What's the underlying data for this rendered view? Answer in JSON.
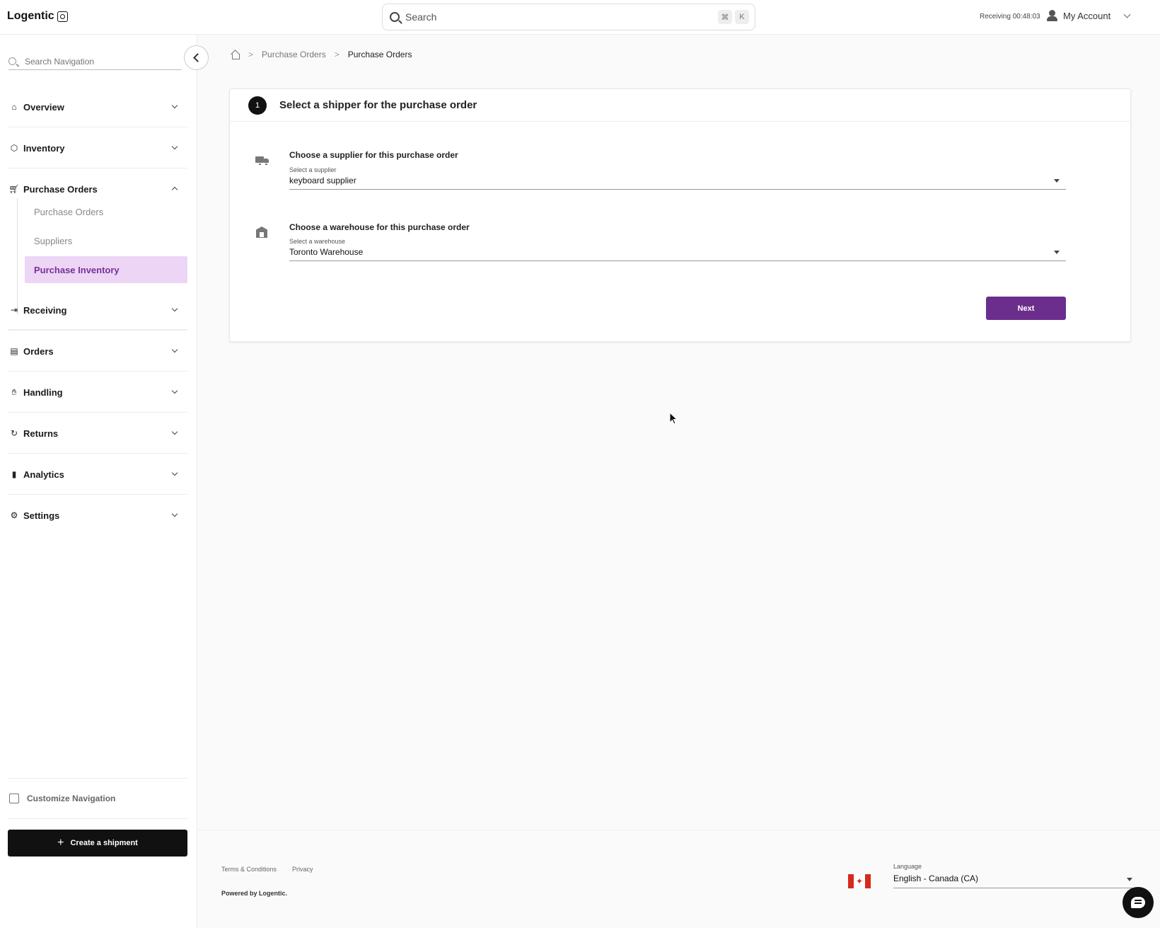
{
  "app": {
    "name": "Logentic"
  },
  "header": {
    "search_label": "Search",
    "shortcut_keys": [
      "⌘",
      "K"
    ],
    "receiving_timer": "Receiving 00:48:03",
    "account_label": "My Account"
  },
  "sidebar": {
    "search_placeholder": "Search Navigation",
    "sections": [
      {
        "label": "Overview",
        "icon": "home-icon",
        "expanded": false
      },
      {
        "label": "Inventory",
        "icon": "box-icon",
        "expanded": false
      },
      {
        "label": "Purchase Orders",
        "icon": "cart-icon",
        "expanded": true
      },
      {
        "label": "Receiving",
        "icon": "receiving-icon",
        "expanded": false
      },
      {
        "label": "Orders",
        "icon": "document-icon",
        "expanded": false
      },
      {
        "label": "Handling",
        "icon": "hand-icon",
        "expanded": false
      },
      {
        "label": "Returns",
        "icon": "return-icon",
        "expanded": false
      },
      {
        "label": "Analytics",
        "icon": "bar-chart-icon",
        "expanded": false
      },
      {
        "label": "Settings",
        "icon": "gear-icon",
        "expanded": false
      }
    ],
    "purchase_orders_items": [
      {
        "label": "Purchase Orders",
        "active": false
      },
      {
        "label": "Suppliers",
        "active": false
      },
      {
        "label": "Purchase Inventory",
        "active": true
      }
    ],
    "customize_label": "Customize Navigation",
    "create_shipment_label": "Create a shipment"
  },
  "breadcrumb": {
    "items": [
      "Purchase Orders",
      "Purchase Orders"
    ]
  },
  "step": {
    "number": "1",
    "title": "Select a shipper for the purchase order",
    "supplier": {
      "label": "Choose a supplier for this purchase order",
      "sublabel": "Select a supplier",
      "value": "keyboard supplier"
    },
    "warehouse": {
      "label": "Choose a warehouse for this purchase order",
      "sublabel": "Select a warehouse",
      "value": "Toronto Warehouse"
    },
    "next_label": "Next"
  },
  "footer": {
    "terms": "Terms & Conditions",
    "privacy": "Privacy",
    "powered_by": "Powered by Logentic.",
    "language_label": "Language",
    "language_value": "English - Canada (CA)"
  },
  "colors": {
    "primary": "#6b2e8c",
    "active_bg": "#ecd5f5",
    "active_text": "#7a2f98"
  }
}
